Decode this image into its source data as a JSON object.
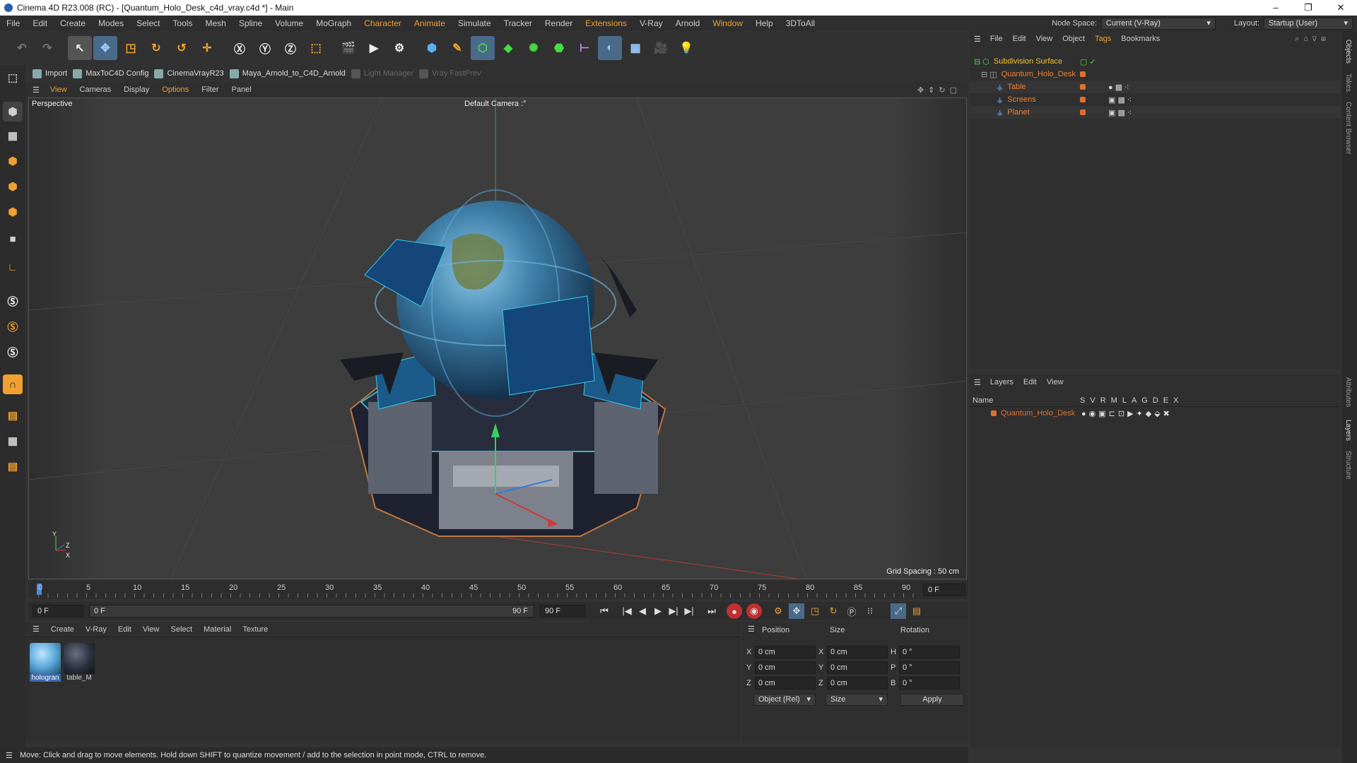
{
  "window": {
    "title": "Cinema 4D R23.008 (RC) - [Quantum_Holo_Desk_c4d_vray.c4d *] - Main",
    "controls": [
      "–",
      "❐",
      "✕"
    ]
  },
  "menu": [
    "File",
    "Edit",
    "Create",
    "Modes",
    "Select",
    "Tools",
    "Mesh",
    "Spline",
    "Volume",
    "MoGraph",
    "Character",
    "Animate",
    "Simulate",
    "Tracker",
    "Render",
    "Extensions",
    "V-Ray",
    "Arnold",
    "Window",
    "Help",
    "3DToAll"
  ],
  "menu_right": {
    "node_space_label": "Node Space:",
    "node_space_value": "Current (V-Ray)",
    "layout_label": "Layout:",
    "layout_value": "Startup (User)"
  },
  "plugins": [
    {
      "label": "Import",
      "enabled": true
    },
    {
      "label": "MaxToC4D Config",
      "enabled": true
    },
    {
      "label": "CinemaVrayR23",
      "enabled": true
    },
    {
      "label": "Maya_Arnold_to_C4D_Arnold",
      "enabled": true
    },
    {
      "label": "Light Manager",
      "enabled": false
    },
    {
      "label": "Vray FastPrev",
      "enabled": false
    }
  ],
  "viewport_menu": [
    "View",
    "Cameras",
    "Display",
    "Options",
    "Filter",
    "Panel"
  ],
  "viewport": {
    "name": "Perspective",
    "camera": "Default Camera",
    "camera_suffix": ":°",
    "grid_spacing": "Grid Spacing : 50 cm",
    "axis_labels": {
      "y": "Y",
      "z": "Z",
      "x": "X"
    }
  },
  "timeline": {
    "ticks": [
      "0",
      "5",
      "10",
      "15",
      "20",
      "25",
      "30",
      "35",
      "40",
      "45",
      "50",
      "55",
      "60",
      "65",
      "70",
      "75",
      "80",
      "85",
      "90"
    ],
    "current_frame": "0 F"
  },
  "transport": {
    "start_frame": "0 F",
    "slider_start": "0 F",
    "slider_end": "90 F",
    "end_frame": "90 F"
  },
  "material_menu": [
    "Create",
    "V-Ray",
    "Edit",
    "View",
    "Select",
    "Material",
    "Texture"
  ],
  "materials": [
    {
      "name": "hologran",
      "color": "#5aa8d8"
    },
    {
      "name": "table_M",
      "color": "#2a3040"
    }
  ],
  "coords": {
    "headers": [
      "Position",
      "Size",
      "Rotation"
    ],
    "rows": [
      {
        "a": "X",
        "pos": "0 cm",
        "b": "X",
        "size": "0 cm",
        "c": "H",
        "rot": "0 °"
      },
      {
        "a": "Y",
        "pos": "0 cm",
        "b": "Y",
        "size": "0 cm",
        "c": "P",
        "rot": "0 °"
      },
      {
        "a": "Z",
        "pos": "0 cm",
        "b": "Z",
        "size": "0 cm",
        "c": "B",
        "rot": "0 °"
      }
    ],
    "mode": "Object (Rel)",
    "size_mode": "Size",
    "apply": "Apply"
  },
  "status": "Move: Click and drag to move elements. Hold down SHIFT to quantize movement / add to the selection in point mode, CTRL to remove.",
  "object_menu": [
    "File",
    "Edit",
    "View",
    "Object",
    "Tags",
    "Bookmarks"
  ],
  "objects": [
    {
      "name": "Subdivision Surface",
      "color": "#f0c030"
    },
    {
      "name": "Quantum_Holo_Desk",
      "color": "#f08030"
    },
    {
      "name": "Table",
      "color": "#f08030"
    },
    {
      "name": "Screens",
      "color": "#f08030"
    },
    {
      "name": "Planet",
      "color": "#f08030"
    }
  ],
  "layers_menu": [
    "Layers",
    "Edit",
    "View"
  ],
  "layer_headers": [
    "Name",
    "S",
    "V",
    "R",
    "M",
    "L",
    "A",
    "G",
    "D",
    "E",
    "X"
  ],
  "layers": [
    {
      "name": "Quantum_Holo_Desk",
      "color": "#e07030"
    }
  ],
  "side_tabs": [
    "Objects",
    "Takes",
    "Content Browser",
    "Attributes",
    "Layers",
    "Structure"
  ],
  "colors": {
    "accent": "#f0a030",
    "object_orange": "#f08030",
    "bg": "#333333"
  }
}
